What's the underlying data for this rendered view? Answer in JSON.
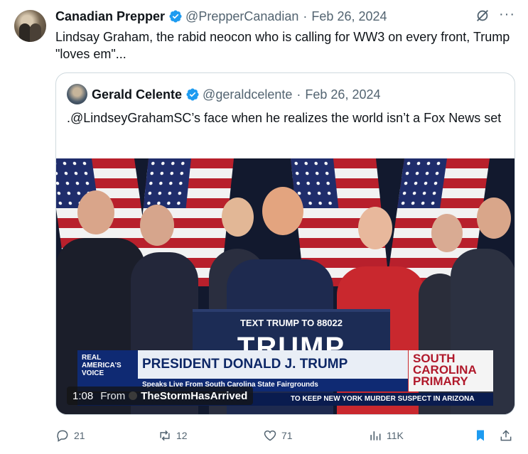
{
  "tweet": {
    "author_name": "Canadian Prepper",
    "author_handle": "@PrepperCanadian",
    "separator": "·",
    "date": "Feb 26, 2024",
    "more_label": "···",
    "text": "Lindsay Graham, the rabid neocon who is calling for WW3 on every front, Trump \"loves em\"..."
  },
  "quote": {
    "author_name": "Gerald Celente",
    "author_handle": "@geraldcelente",
    "separator": "·",
    "date": "Feb 26, 2024",
    "text": ".@LindseyGrahamSC’s face when he realizes the world isn’t a Fox News set"
  },
  "video": {
    "podium_small": "TEXT TRUMP TO 88022",
    "podium_big": "TRUMP",
    "network_logo": "REAL AMERICA'S VOICE",
    "chyron_main": "PRESIDENT DONALD J. TRUMP",
    "chyron_sub": "Speaks Live From South Carolina State Fairgrounds",
    "chyron_side": "SOUTH CAROLINA PRIMARY",
    "ticker": "TO KEEP NEW YORK MURDER SUSPECT IN ARIZONA",
    "time": "1:08",
    "from_label": "From",
    "source": "TheStormHasArrived"
  },
  "actions": {
    "replies": "21",
    "reposts": "12",
    "likes": "71",
    "views": "11K"
  },
  "colors": {
    "accent": "#1d9bf0",
    "muted": "#536471",
    "text": "#0f1419",
    "border": "#cfd9de"
  },
  "icons": [
    "verified-badge-icon",
    "grok-icon",
    "more-icon",
    "reply-icon",
    "repost-icon",
    "like-icon",
    "views-icon",
    "bookmark-icon",
    "share-icon"
  ]
}
